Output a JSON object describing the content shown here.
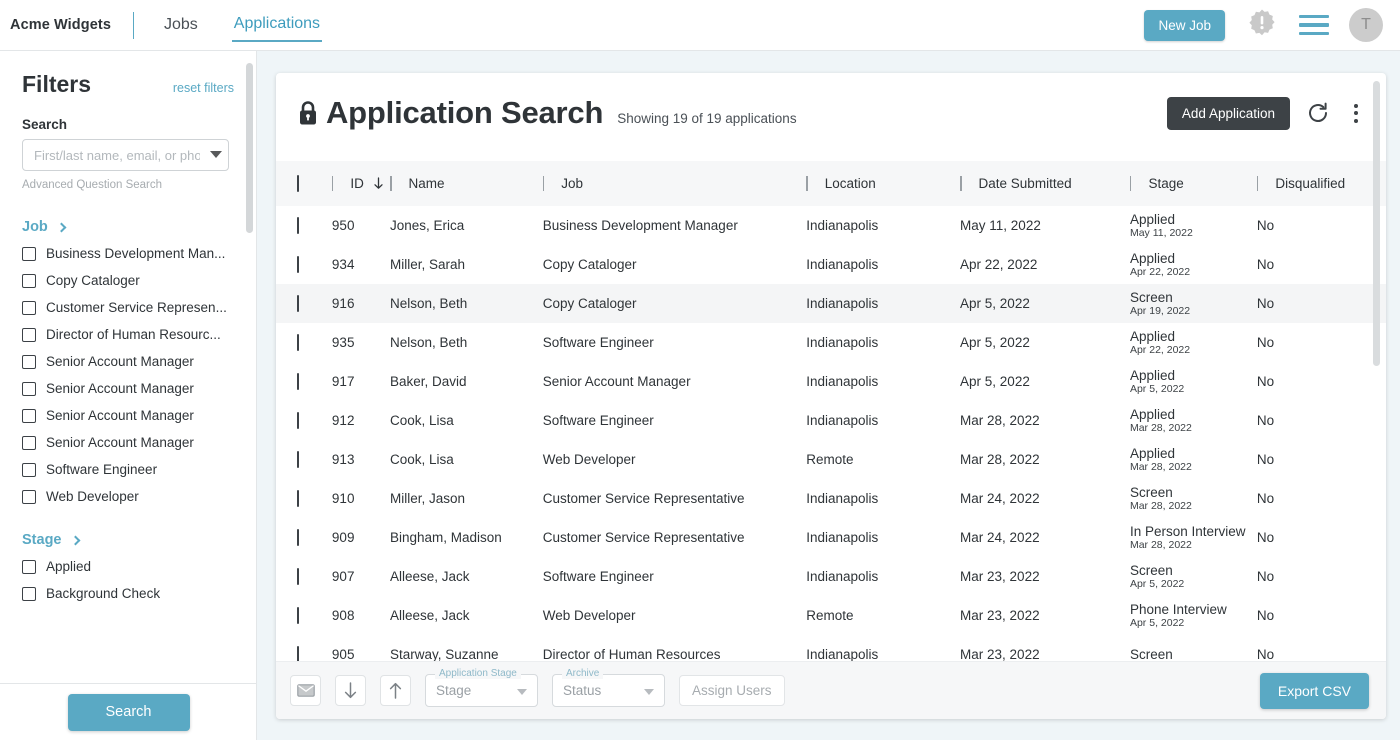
{
  "topnav": {
    "brand": "Acme Widgets",
    "tabs": [
      {
        "label": "Jobs",
        "active": false
      },
      {
        "label": "Applications",
        "active": true
      }
    ],
    "new_job_label": "New Job",
    "avatar_initial": "T",
    "accent_color": "#5aa9c4"
  },
  "sidebar": {
    "title": "Filters",
    "reset_label": "reset filters",
    "search_label": "Search",
    "search_placeholder": "First/last name, email, or phone",
    "search_value": "",
    "advanced_label": "Advanced Question Search",
    "groups": [
      {
        "label": "Job",
        "items": [
          "Business Development Man...",
          "Copy Cataloger",
          "Customer Service Represen...",
          "Director of Human Resourc...",
          "Senior Account Manager",
          "Senior Account Manager",
          "Senior Account Manager",
          "Senior Account Manager",
          "Software Engineer",
          "Web Developer"
        ]
      },
      {
        "label": "Stage",
        "items": [
          "Applied",
          "Background Check"
        ]
      }
    ],
    "search_button": "Search"
  },
  "main": {
    "title": "Application Search",
    "showing": "Showing 19 of 19 applications",
    "add_application_label": "Add Application",
    "columns": [
      "ID",
      "Name",
      "Job",
      "Location",
      "Date Submitted",
      "Stage",
      "Disqualified"
    ],
    "sort_column": "ID",
    "sort_direction": "desc",
    "rows": [
      {
        "id": "950",
        "name": "Jones, Erica",
        "job": "Business Development Manager",
        "location": "Indianapolis",
        "date": "May 11, 2022",
        "stage": "Applied",
        "stage_date": "May 11, 2022",
        "disqualified": "No",
        "highlight": false
      },
      {
        "id": "934",
        "name": "Miller, Sarah",
        "job": "Copy Cataloger",
        "location": "Indianapolis",
        "date": "Apr 22, 2022",
        "stage": "Applied",
        "stage_date": "Apr 22, 2022",
        "disqualified": "No",
        "highlight": false
      },
      {
        "id": "916",
        "name": "Nelson, Beth",
        "job": "Copy Cataloger",
        "location": "Indianapolis",
        "date": "Apr 5, 2022",
        "stage": "Screen",
        "stage_date": "Apr 19, 2022",
        "disqualified": "No",
        "highlight": true
      },
      {
        "id": "935",
        "name": "Nelson, Beth",
        "job": "Software Engineer",
        "location": "Indianapolis",
        "date": "Apr 5, 2022",
        "stage": "Applied",
        "stage_date": "Apr 22, 2022",
        "disqualified": "No",
        "highlight": false
      },
      {
        "id": "917",
        "name": "Baker, David",
        "job": "Senior Account Manager",
        "location": "Indianapolis",
        "date": "Apr 5, 2022",
        "stage": "Applied",
        "stage_date": "Apr 5, 2022",
        "disqualified": "No",
        "highlight": false
      },
      {
        "id": "912",
        "name": "Cook, Lisa",
        "job": "Software Engineer",
        "location": "Indianapolis",
        "date": "Mar 28, 2022",
        "stage": "Applied",
        "stage_date": "Mar 28, 2022",
        "disqualified": "No",
        "highlight": false
      },
      {
        "id": "913",
        "name": "Cook, Lisa",
        "job": "Web Developer",
        "location": "Remote",
        "date": "Mar 28, 2022",
        "stage": "Applied",
        "stage_date": "Mar 28, 2022",
        "disqualified": "No",
        "highlight": false
      },
      {
        "id": "910",
        "name": "Miller, Jason",
        "job": "Customer Service Representative",
        "location": "Indianapolis",
        "date": "Mar 24, 2022",
        "stage": "Screen",
        "stage_date": "Mar 28, 2022",
        "disqualified": "No",
        "highlight": false
      },
      {
        "id": "909",
        "name": "Bingham, Madison",
        "job": "Customer Service Representative",
        "location": "Indianapolis",
        "date": "Mar 24, 2022",
        "stage": "In Person Interview",
        "stage_date": "Mar 28, 2022",
        "disqualified": "No",
        "highlight": false
      },
      {
        "id": "907",
        "name": "Alleese, Jack",
        "job": "Software Engineer",
        "location": "Indianapolis",
        "date": "Mar 23, 2022",
        "stage": "Screen",
        "stage_date": "Apr 5, 2022",
        "disqualified": "No",
        "highlight": false
      },
      {
        "id": "908",
        "name": "Alleese, Jack",
        "job": "Web Developer",
        "location": "Remote",
        "date": "Mar 23, 2022",
        "stage": "Phone Interview",
        "stage_date": "Apr 5, 2022",
        "disqualified": "No",
        "highlight": false
      },
      {
        "id": "905",
        "name": "Starway, Suzanne",
        "job": "Director of Human Resources",
        "location": "Indianapolis",
        "date": "Mar 23, 2022",
        "stage": "Screen",
        "stage_date": "",
        "disqualified": "No",
        "highlight": false
      }
    ]
  },
  "bottombar": {
    "stage_legend": "Application Stage",
    "stage_value": "Stage",
    "archive_legend": "Archive",
    "archive_value": "Status",
    "assign_users_label": "Assign Users",
    "export_label": "Export CSV"
  }
}
